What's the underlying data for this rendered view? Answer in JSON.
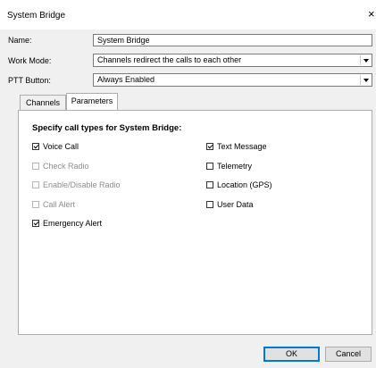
{
  "window": {
    "title": "System Bridge"
  },
  "form": {
    "name_label": "Name:",
    "name_value": "System Bridge",
    "work_mode_label": "Work Mode:",
    "work_mode_value": "Channels redirect the calls to each other",
    "ptt_label": "PTT Button:",
    "ptt_value": "Always Enabled"
  },
  "tabs": [
    {
      "label": "Channels",
      "active": false
    },
    {
      "label": "Parameters",
      "active": true
    }
  ],
  "parameters": {
    "heading": "Specify call types for System Bridge:",
    "left": [
      {
        "label": "Voice Call",
        "checked": true,
        "enabled": true
      },
      {
        "label": "Check Radio",
        "checked": false,
        "enabled": false
      },
      {
        "label": "Enable/Disable Radio",
        "checked": false,
        "enabled": false
      },
      {
        "label": "Call Alert",
        "checked": false,
        "enabled": false
      },
      {
        "label": "Emergency Alert",
        "checked": true,
        "enabled": true
      }
    ],
    "right": [
      {
        "label": "Text Message",
        "checked": true,
        "enabled": true
      },
      {
        "label": "Telemetry",
        "checked": false,
        "enabled": true
      },
      {
        "label": "Location (GPS)",
        "checked": false,
        "enabled": true
      },
      {
        "label": "User Data",
        "checked": false,
        "enabled": true
      }
    ]
  },
  "buttons": {
    "ok": "OK",
    "cancel": "Cancel"
  }
}
